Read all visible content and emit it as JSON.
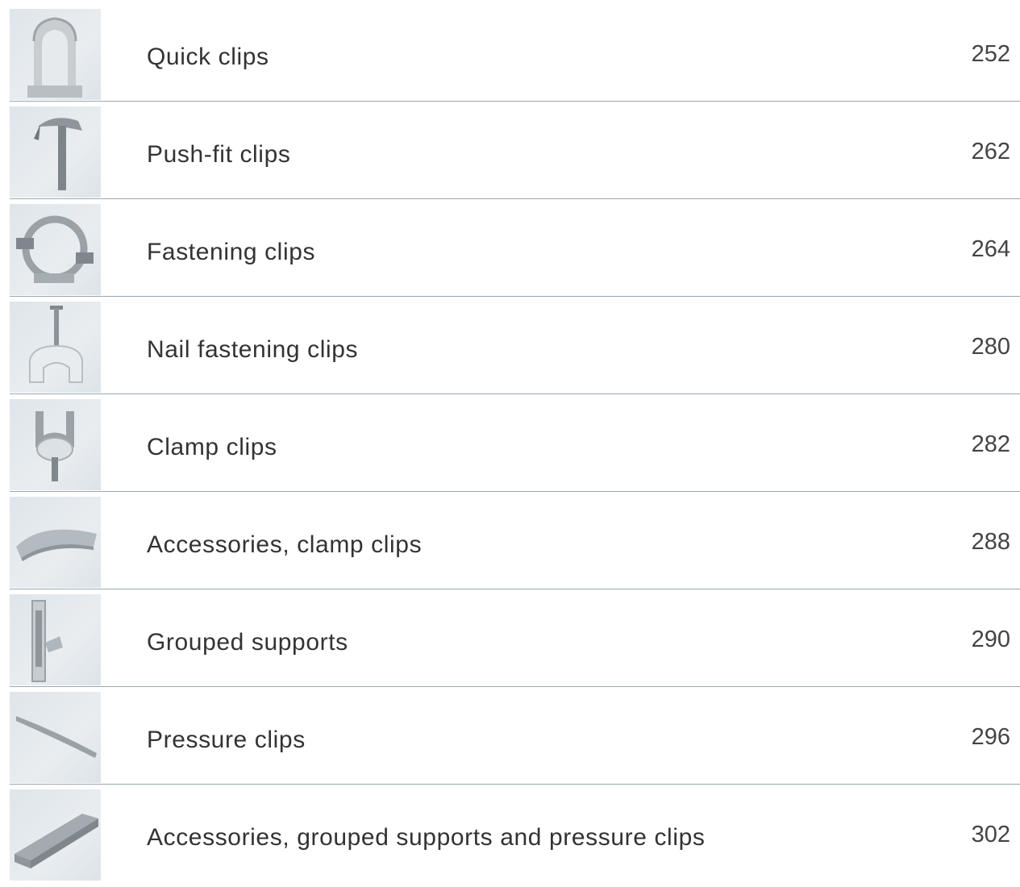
{
  "items": [
    {
      "label": "Quick clips",
      "page": "252",
      "icon": "quick-clip-icon"
    },
    {
      "label": "Push-fit clips",
      "page": "262",
      "icon": "push-fit-clip-icon"
    },
    {
      "label": "Fastening clips",
      "page": "264",
      "icon": "fastening-clip-icon"
    },
    {
      "label": "Nail fastening clips",
      "page": "280",
      "icon": "nail-clip-icon"
    },
    {
      "label": "Clamp clips",
      "page": "282",
      "icon": "clamp-clip-icon"
    },
    {
      "label": "Accessories, clamp clips",
      "page": "288",
      "icon": "clamp-accessory-icon"
    },
    {
      "label": "Grouped supports",
      "page": "290",
      "icon": "grouped-support-icon"
    },
    {
      "label": "Pressure clips",
      "page": "296",
      "icon": "pressure-clip-icon"
    },
    {
      "label": "Accessories, grouped supports and pressure clips",
      "page": "302",
      "icon": "channel-accessory-icon"
    }
  ]
}
